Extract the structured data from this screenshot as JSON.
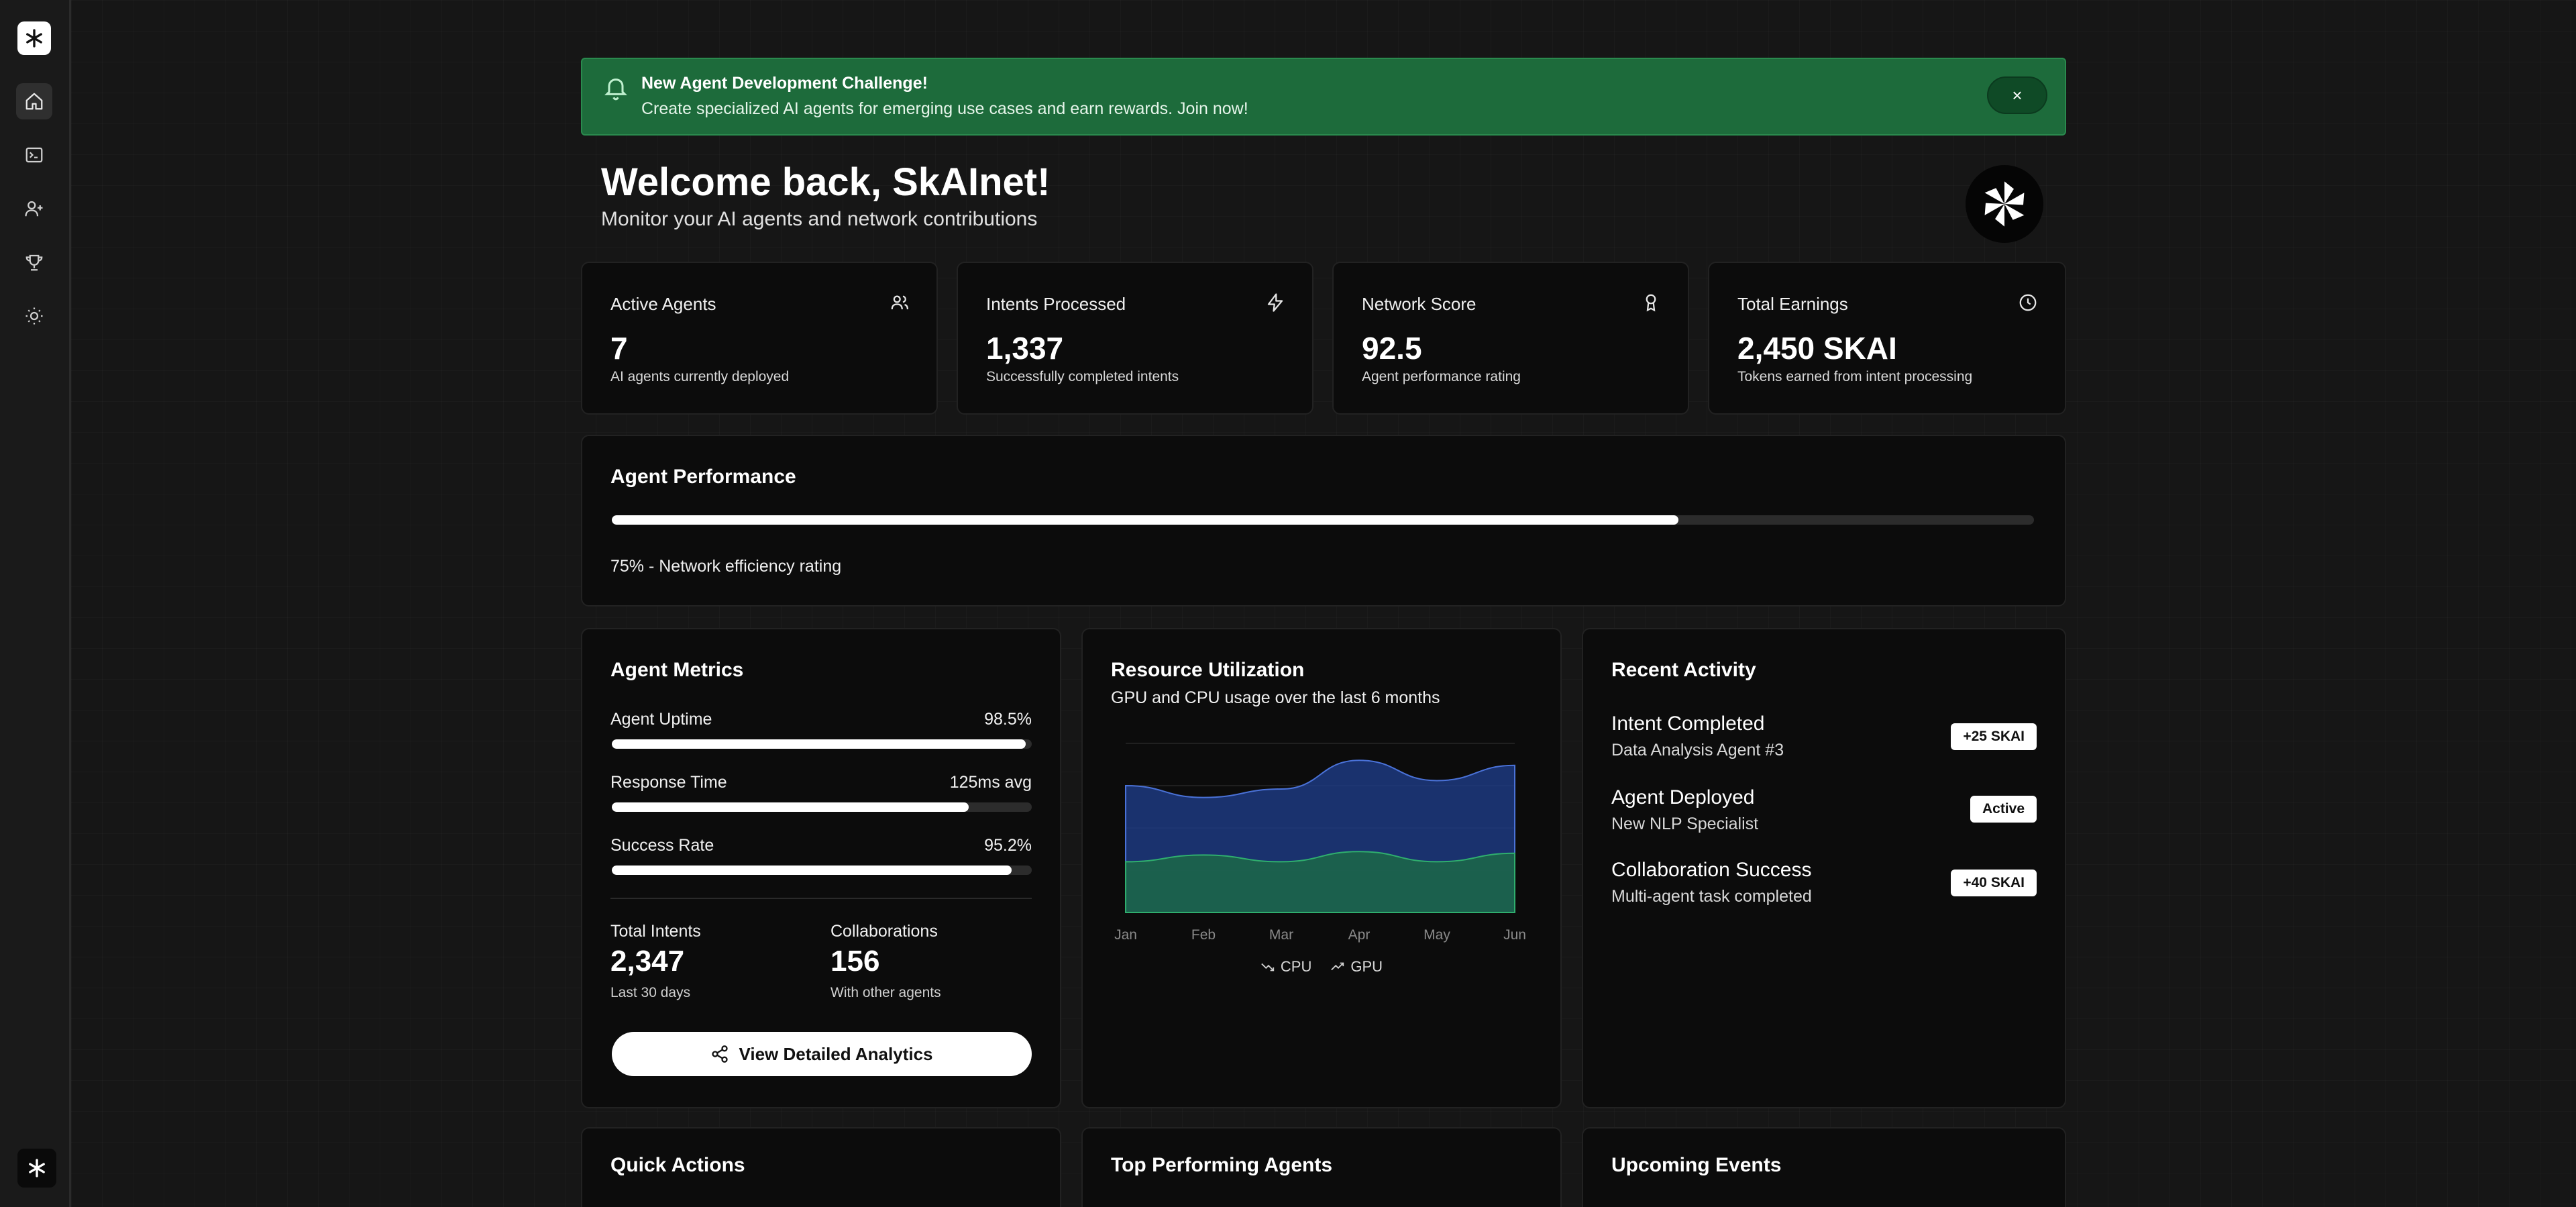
{
  "banner": {
    "title": "New Agent Development Challenge!",
    "text": "Create specialized AI agents for emerging use cases and earn rewards. Join now!",
    "close_icon": "×"
  },
  "welcome": {
    "title": "Welcome back, SkAInet!",
    "subtitle": "Monitor your AI agents and network contributions"
  },
  "stats": [
    {
      "title": "Active Agents",
      "value": "7",
      "desc": "AI agents currently deployed",
      "icon": "users-icon"
    },
    {
      "title": "Intents Processed",
      "value": "1,337",
      "desc": "Successfully completed intents",
      "icon": "zap-icon"
    },
    {
      "title": "Network Score",
      "value": "92.5",
      "desc": "Agent performance rating",
      "icon": "award-icon"
    },
    {
      "title": "Total Earnings",
      "value": "2,450 SKAI",
      "desc": "Tokens earned from intent processing",
      "icon": "clock-icon"
    }
  ],
  "performance": {
    "title": "Agent Performance",
    "percent": 75,
    "label": "75% - Network efficiency rating"
  },
  "agent_metrics": {
    "title": "Agent Metrics",
    "rows": [
      {
        "label": "Agent Uptime",
        "value": "98.5%",
        "fill": 98.5
      },
      {
        "label": "Response Time",
        "value": "125ms avg",
        "fill": 85
      },
      {
        "label": "Success Rate",
        "value": "95.2%",
        "fill": 95.2
      }
    ],
    "total_intents": {
      "label": "Total Intents",
      "value": "2,347",
      "sub": "Last 30 days"
    },
    "collaborations": {
      "label": "Collaborations",
      "value": "156",
      "sub": "With other agents"
    },
    "button": "View Detailed Analytics"
  },
  "resource": {
    "title": "Resource Utilization",
    "subtitle": "GPU and CPU usage over the last 6 months",
    "months": [
      "Jan",
      "Feb",
      "Mar",
      "Apr",
      "May",
      "Jun"
    ],
    "legend_cpu": "CPU",
    "legend_gpu": "GPU",
    "colors": {
      "gpu": "#1f3f8f",
      "cpu": "#1b6b45"
    }
  },
  "chart_data": {
    "type": "area",
    "x": [
      "Jan",
      "Feb",
      "Mar",
      "Apr",
      "May",
      "Jun"
    ],
    "series": [
      {
        "name": "CPU",
        "values": [
          30,
          34,
          30,
          36,
          30,
          35
        ]
      },
      {
        "name": "GPU",
        "values": [
          75,
          68,
          73,
          90,
          78,
          87
        ]
      }
    ],
    "ylim": [
      0,
      100
    ],
    "legend": "bottom"
  },
  "activity": {
    "title": "Recent Activity",
    "items": [
      {
        "title": "Intent Completed",
        "sub": "Data Analysis Agent #3",
        "badge": "+25 SKAI"
      },
      {
        "title": "Agent Deployed",
        "sub": "New NLP Specialist",
        "badge": "Active"
      },
      {
        "title": "Collaboration Success",
        "sub": "Multi-agent task completed",
        "badge": "+40 SKAI"
      }
    ]
  },
  "bottom": {
    "quick_actions": "Quick Actions",
    "top_agents": "Top Performing Agents",
    "events": "Upcoming Events"
  },
  "nav": [
    {
      "name": "home-icon"
    },
    {
      "name": "terminal-icon"
    },
    {
      "name": "user-plus-icon"
    },
    {
      "name": "trophy-icon"
    },
    {
      "name": "sun-icon"
    }
  ]
}
